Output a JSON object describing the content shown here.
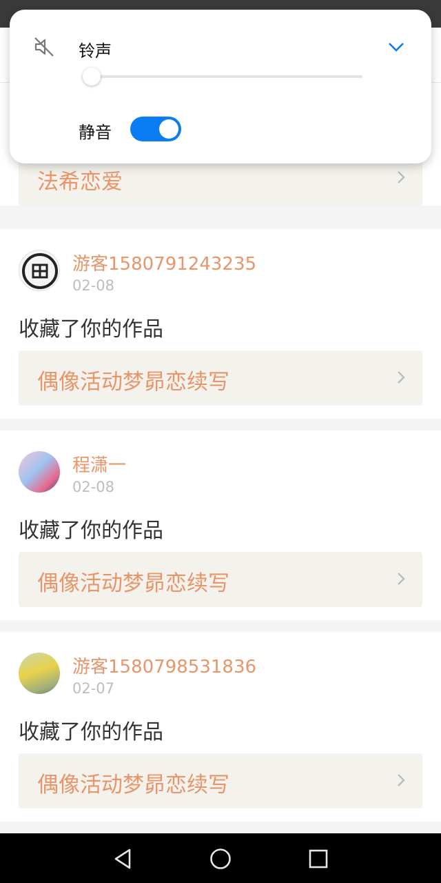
{
  "volume_panel": {
    "label": "铃声",
    "level": 0,
    "mute_label": "静音",
    "mute_on": true,
    "accent": "#0a7df5"
  },
  "feed": [
    {
      "work_title": "法希恋爱"
    },
    {
      "username": "游客1580791243235",
      "date": "02-08",
      "action": "收藏了你的作品",
      "work_title": "偶像活动梦昴恋续写"
    },
    {
      "username": "程潇一",
      "date": "02-08",
      "action": "收藏了你的作品",
      "work_title": "偶像活动梦昴恋续写"
    },
    {
      "username": "游客1580798531836",
      "date": "02-07",
      "action": "收藏了你的作品",
      "work_title": "偶像活动梦昴恋续写"
    }
  ],
  "colors": {
    "username": "#e8956a",
    "work_title": "#e8956a",
    "date": "#bdbdbd",
    "link_bg": "#f4f2ec"
  },
  "icons": [
    "mute-icon",
    "chevron-down-icon",
    "chevron-right-icon",
    "back-icon",
    "home-icon",
    "recents-icon"
  ]
}
